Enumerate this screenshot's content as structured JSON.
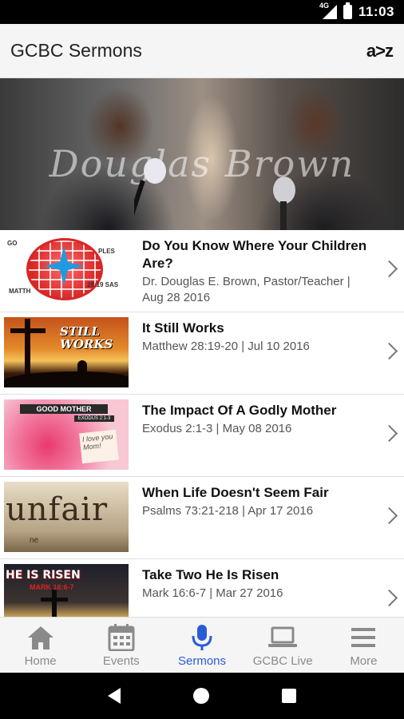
{
  "status_bar": {
    "network": "4G",
    "time": "11:03"
  },
  "app_bar": {
    "title": "GCBC Sermons",
    "sort_label": "a>z"
  },
  "hero": {
    "overlay_text": "Douglas Brown"
  },
  "sermons": [
    {
      "title": "Do You Know Where Your Children Are?",
      "subtitle": "Dr. Douglas E. Brown, Pastor/Teacher | Aug 28 2016",
      "thumb": {
        "type": "globe",
        "label_top": "GO",
        "label_right": "PLES",
        "label_bottom_left": "MATTH",
        "label_bottom_right": "28:19 SAS"
      }
    },
    {
      "title": "It Still Works",
      "subtitle": "Matthew 28:19-20 | Jul 10 2016",
      "thumb": {
        "type": "cross-sunset",
        "text": "STILL WORKS"
      }
    },
    {
      "title": "The Impact Of A Godly Mother",
      "subtitle": "Exodus 2:1-3 | May 08 2016",
      "thumb": {
        "type": "rose",
        "banner": "GOOD MOTHER",
        "banner2": "EXODUS 2:1-3",
        "note": "I love you Mom!"
      }
    },
    {
      "title": "When Life Doesn't Seem Fair",
      "subtitle": "Psalms 73:21-218 | Apr 17 2016",
      "thumb": {
        "type": "unfair",
        "word": "unfair",
        "small": "ne"
      }
    },
    {
      "title": "Take Two He Is Risen",
      "subtitle": "Mark 16:6-7 | Mar 27 2016",
      "thumb": {
        "type": "risen",
        "header": "HE IS RISEN",
        "mark": "MARK 16:6-7"
      }
    }
  ],
  "bottom_nav": [
    {
      "label": "Home",
      "icon": "home-icon",
      "active": false
    },
    {
      "label": "Events",
      "icon": "calendar-icon",
      "active": false
    },
    {
      "label": "Sermons",
      "icon": "microphone-icon",
      "active": true
    },
    {
      "label": "GCBC Live",
      "icon": "laptop-icon",
      "active": false
    },
    {
      "label": "More",
      "icon": "menu-icon",
      "active": false
    }
  ],
  "colors": {
    "accent": "#2a5bd7",
    "inactive": "#8a8a8a",
    "appbar_bg": "#f5f5f5"
  }
}
